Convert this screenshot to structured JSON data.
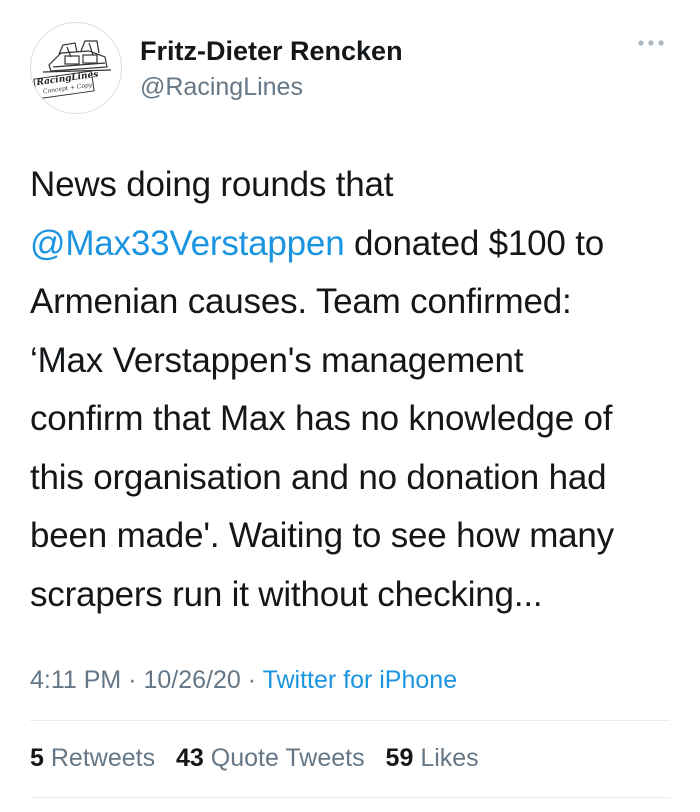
{
  "author": {
    "display_name": "Fritz-Dieter Rencken",
    "handle": "@RacingLines",
    "avatar_logo_text": "RacingLines",
    "avatar_logo_subtext": "Concept + Copy"
  },
  "more_icon": "more-horizontal-icon",
  "tweet": {
    "line1": "News doing rounds that",
    "mention": "@Max33Verstappen",
    "line2_rest": " donated $100 to",
    "line3": "Armenian causes. Team confirmed:",
    "line4": "‘Max Verstappen's management",
    "line5": "confirm that Max has no knowledge of",
    "line6": "this organisation and no donation had",
    "line7": "been made'. Waiting to see how many",
    "line8": "scrapers run it without checking..."
  },
  "meta": {
    "time": "4:11 PM",
    "sep1": " · ",
    "date": "10/26/20",
    "sep2": " · ",
    "source": "Twitter for iPhone"
  },
  "stats": {
    "retweets_count": "5",
    "retweets_label": "Retweets",
    "quotes_count": "43",
    "quotes_label": "Quote Tweets",
    "likes_count": "59",
    "likes_label": "Likes"
  },
  "colors": {
    "link": "#1b95e0",
    "secondary_text": "#657786",
    "primary_text": "#14171a",
    "divider": "#e6ecf0"
  }
}
